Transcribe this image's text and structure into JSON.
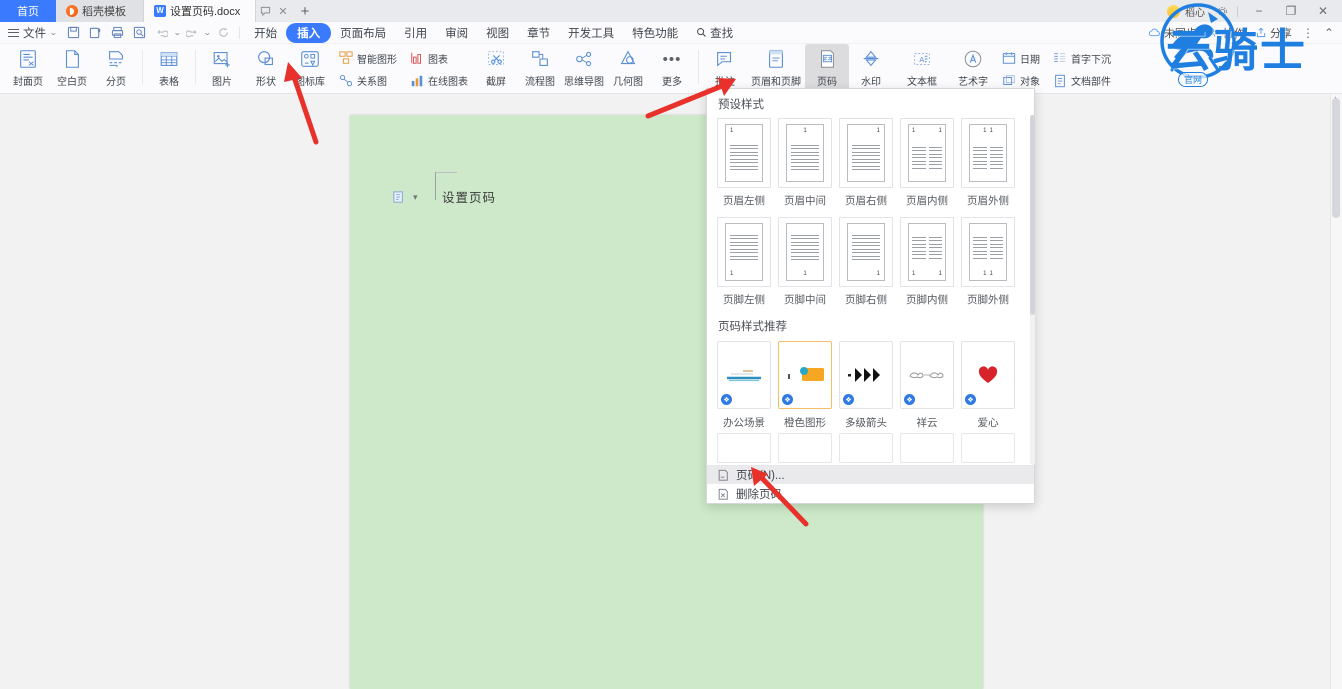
{
  "titlebar": {
    "tabs": [
      {
        "label": "首页",
        "icon": "home-icon",
        "type": "home"
      },
      {
        "label": "稻壳模板",
        "icon": "docer-icon",
        "type": "normal"
      },
      {
        "label": "设置页码.docx",
        "icon": "word-doc-icon",
        "type": "active"
      }
    ],
    "tab_tooltip_icon": "comment-icon",
    "tab_close_icon": "close-icon",
    "new_tab_icon": "plus-icon",
    "user_name": "稻心",
    "window_minimize": "−",
    "window_restore": "❐",
    "window_close": "✕"
  },
  "menubar": {
    "file_label": "文件",
    "quick_icons": [
      "save-icon",
      "save-as-icon",
      "print-icon",
      "print-preview-icon",
      "undo-icon",
      "redo-icon",
      "refresh-icon"
    ],
    "items": [
      {
        "label": "开始",
        "active": false
      },
      {
        "label": "插入",
        "active": true
      },
      {
        "label": "页面布局",
        "active": false
      },
      {
        "label": "引用",
        "active": false
      },
      {
        "label": "审阅",
        "active": false
      },
      {
        "label": "视图",
        "active": false
      },
      {
        "label": "章节",
        "active": false
      },
      {
        "label": "开发工具",
        "active": false
      },
      {
        "label": "特色功能",
        "active": false
      }
    ],
    "search_label": "查找",
    "search_icon": "search-icon",
    "right_items": [
      {
        "label": "未同步",
        "icon": "cloud-sync-icon"
      },
      {
        "label": "协作",
        "icon": "collaborate-icon"
      },
      {
        "label": "分享",
        "icon": "share-icon"
      }
    ],
    "more_icon": "more-vertical-icon",
    "collapse_icon": "chevron-up-icon"
  },
  "ribbon": {
    "groups": [
      {
        "items": [
          {
            "label": "封面页",
            "icon": "cover-page-icon",
            "dropdown": true
          },
          {
            "label": "空白页",
            "icon": "blank-page-icon",
            "dropdown": true
          },
          {
            "label": "分页",
            "icon": "page-break-icon",
            "dropdown": true
          }
        ]
      },
      {
        "items": [
          {
            "label": "表格",
            "icon": "table-icon",
            "dropdown": true
          }
        ]
      },
      {
        "items": [
          {
            "label": "图片",
            "icon": "picture-icon",
            "dropdown": true
          },
          {
            "label": "形状",
            "icon": "shape-icon",
            "dropdown": true
          },
          {
            "label": "图标库",
            "icon": "icon-library-icon",
            "dropdown": false
          }
        ]
      },
      {
        "stacked": [
          {
            "label": "智能图形",
            "icon": "smartart-icon"
          },
          {
            "label": "关系图",
            "icon": "relation-chart-icon"
          }
        ]
      },
      {
        "stacked": [
          {
            "label": "图表",
            "icon": "chart-icon"
          },
          {
            "label": "在线图表",
            "icon": "online-chart-icon"
          }
        ]
      },
      {
        "items": [
          {
            "label": "截屏",
            "icon": "screenshot-icon",
            "dropdown": true
          },
          {
            "label": "流程图",
            "icon": "flowchart-icon",
            "dropdown": true
          },
          {
            "label": "思维导图",
            "icon": "mindmap-icon",
            "dropdown": true
          },
          {
            "label": "几何图",
            "icon": "geometry-icon",
            "dropdown": false
          },
          {
            "label": "更多",
            "icon": "more-dots-icon",
            "dropdown": true
          }
        ]
      },
      {
        "items": [
          {
            "label": "批注",
            "icon": "comment-insert-icon",
            "dropdown": false
          },
          {
            "label": "页眉和页脚",
            "icon": "header-footer-icon",
            "dropdown": false
          },
          {
            "label": "页码",
            "icon": "page-number-icon",
            "dropdown": true,
            "pressed": true
          },
          {
            "label": "水印",
            "icon": "watermark-icon",
            "dropdown": true
          },
          {
            "label": "文本框",
            "icon": "textbox-icon",
            "dropdown": true
          },
          {
            "label": "艺术字",
            "icon": "wordart-icon",
            "dropdown": true
          }
        ]
      },
      {
        "stacked": [
          {
            "label": "日期",
            "icon": "date-icon"
          },
          {
            "label": "对象",
            "icon": "object-icon"
          }
        ]
      },
      {
        "stacked": [
          {
            "label": "首字下沉",
            "icon": "dropcap-icon"
          },
          {
            "label": "文档部件",
            "icon": "doc-parts-icon"
          }
        ]
      }
    ]
  },
  "document": {
    "paste_icon": "paste-options-icon",
    "paste_dropdown": "▾",
    "body_text": "设置页码",
    "page_background_color": "#cde9c9"
  },
  "panel": {
    "preset_title": "预设样式",
    "header_styles": [
      {
        "label": "页眉左侧",
        "layout": "single",
        "number_pos": "left",
        "number_at": "top",
        "number": "1"
      },
      {
        "label": "页眉中间",
        "layout": "single",
        "number_pos": "center",
        "number_at": "top",
        "number": "1"
      },
      {
        "label": "页眉右侧",
        "layout": "single",
        "number_pos": "right",
        "number_at": "top",
        "number": "1"
      },
      {
        "label": "页眉内侧",
        "layout": "split",
        "number_pos": "inner",
        "number_at": "top",
        "number": "1"
      },
      {
        "label": "页眉外侧",
        "layout": "split",
        "number_pos": "outer",
        "number_at": "top",
        "number": "1"
      }
    ],
    "footer_styles": [
      {
        "label": "页脚左侧",
        "layout": "single",
        "number_pos": "left",
        "number_at": "bottom",
        "number": "1"
      },
      {
        "label": "页脚中间",
        "layout": "single",
        "number_pos": "center",
        "number_at": "bottom",
        "number": "1"
      },
      {
        "label": "页脚右侧",
        "layout": "single",
        "number_pos": "right",
        "number_at": "bottom",
        "number": "1"
      },
      {
        "label": "页脚内侧",
        "layout": "split",
        "number_pos": "inner",
        "number_at": "bottom",
        "number": "1"
      },
      {
        "label": "页脚外侧",
        "layout": "split",
        "number_pos": "outer",
        "number_at": "bottom",
        "number": "1"
      }
    ],
    "recommend_title": "页码样式推荐",
    "recommended_styles": [
      {
        "label": "办公场景",
        "badge": "docer-vip-badge",
        "selected": false
      },
      {
        "label": "橙色图形",
        "badge": "docer-vip-badge",
        "selected": true
      },
      {
        "label": "多级箭头",
        "badge": "docer-vip-badge",
        "selected": false
      },
      {
        "label": "祥云",
        "badge": "docer-vip-badge",
        "selected": false
      },
      {
        "label": "爱心",
        "badge": "docer-vip-badge",
        "selected": false
      }
    ],
    "menu_items": [
      {
        "label": "页码(N)...",
        "icon": "page-number-menu-icon",
        "highlighted": true
      },
      {
        "label": "删除页码",
        "icon": "delete-page-number-icon",
        "highlighted": false
      }
    ]
  },
  "watermark": {
    "text": "云骑士",
    "emblem": "horse-rider-emblem",
    "badge": "官网",
    "color": "#1f7fe0"
  },
  "annotations": {
    "arrow_color": "#e8312a",
    "arrows": [
      "insert-tab-arrow",
      "page-number-button-arrow",
      "page-number-menu-arrow"
    ]
  }
}
